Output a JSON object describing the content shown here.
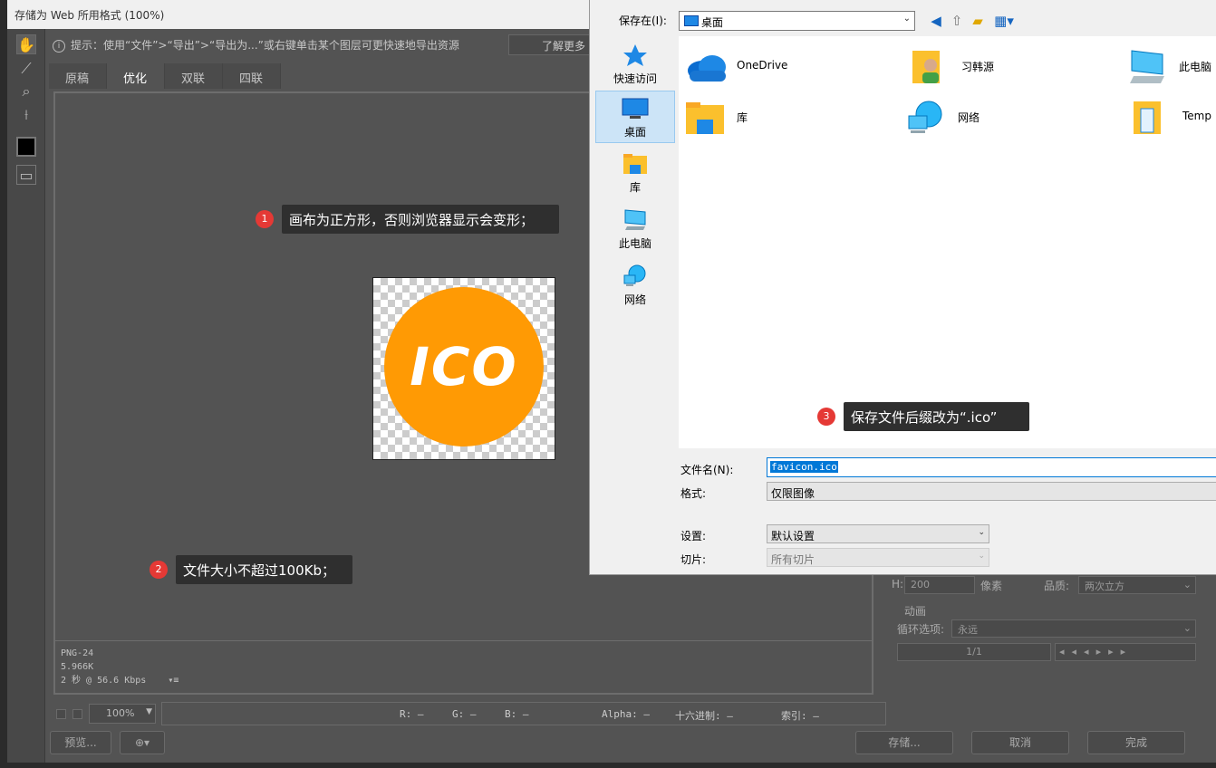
{
  "ps": {
    "title": "存储为 Web 所用格式 (100%)",
    "hint": "提示：使用“文件”>“导出”>“导出为...”或右键单击某个图层可更快速地导出资源",
    "learn_more": "了解更多",
    "tabs": [
      {
        "label": "原稿"
      },
      {
        "label": "优化"
      },
      {
        "label": "双联"
      },
      {
        "label": "四联"
      }
    ],
    "info": {
      "format": "PNG-24",
      "size": "5.966K",
      "time": "2 秒 @ 56.6 Kbps",
      "menu_glyph": "▾≡"
    },
    "preview_text": "ICO",
    "zoom": "100%",
    "readout": {
      "r": "R: —",
      "g": "G: —",
      "b": "B: —",
      "alpha": "Alpha: —",
      "hex": "十六进制: —",
      "index": "索引: —"
    },
    "buttons": {
      "preview": "预览...",
      "save": "存储...",
      "cancel": "取消",
      "done": "完成"
    },
    "right_panel": {
      "h_label": "H:",
      "h_value": "200",
      "unit": "像素",
      "quality_label": "品质:",
      "quality_value": "两次立方",
      "animation_title": "动画",
      "loop_label": "循环选项:",
      "loop_value": "永远",
      "frame_counter": "1/1"
    }
  },
  "dialog": {
    "save_in_label": "保存在(I):",
    "save_in_value": "桌面",
    "places": [
      {
        "label": "快速访问"
      },
      {
        "label": "桌面"
      },
      {
        "label": "库"
      },
      {
        "label": "此电脑"
      },
      {
        "label": "网络"
      }
    ],
    "files": [
      {
        "label": "OneDrive"
      },
      {
        "label": "习韩源"
      },
      {
        "label": "此电脑"
      },
      {
        "label": "库"
      },
      {
        "label": "网络"
      },
      {
        "label": "Temp"
      }
    ],
    "filename_label": "文件名(N):",
    "filename_value": "favicon.ico",
    "format_label": "格式:",
    "format_value": "仅限图像",
    "settings_label": "设置:",
    "settings_value": "默认设置",
    "slices_label": "切片:",
    "slices_value": "所有切片"
  },
  "callouts": [
    {
      "num": "1",
      "text": "画布为正方形，否则浏览器显示会变形；"
    },
    {
      "num": "2",
      "text": "文件大小不超过100Kb；"
    },
    {
      "num": "3",
      "text": "保存文件后缀改为“.ico”"
    }
  ],
  "colors": {
    "accent_orange": "#ff9a04",
    "callout_red": "#e53935",
    "selection_blue": "#0078d7"
  }
}
